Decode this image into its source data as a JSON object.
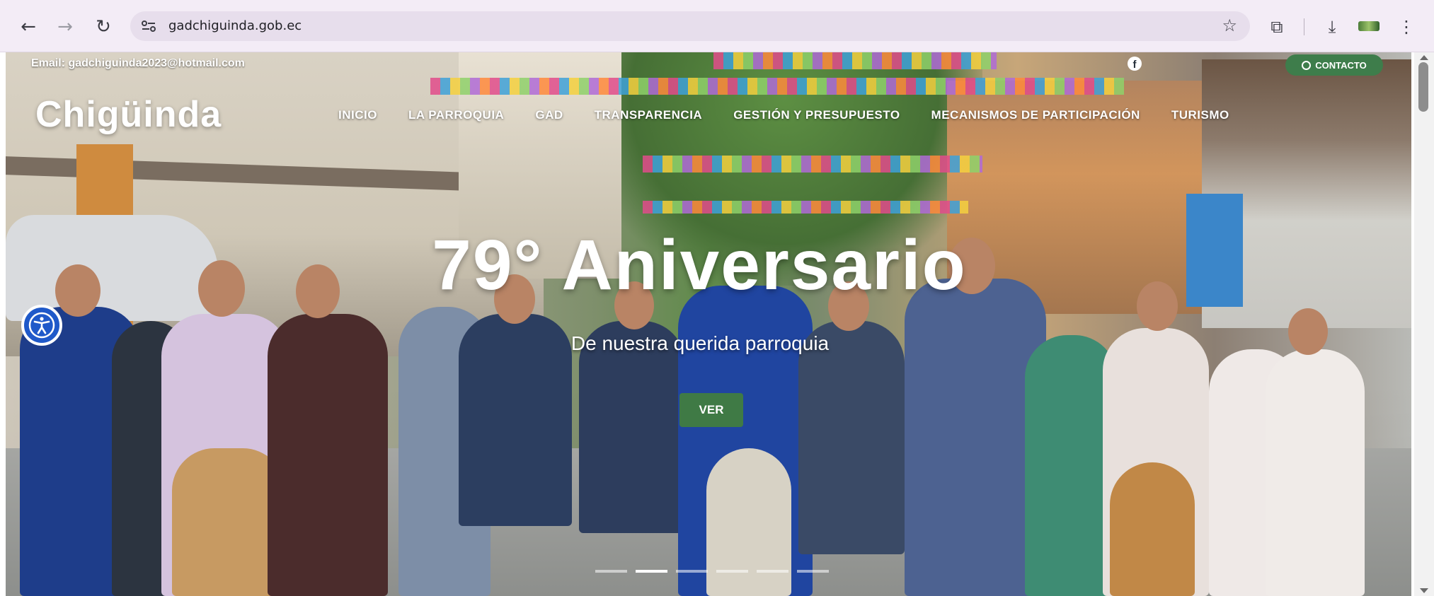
{
  "browser": {
    "url": "gadchiguinda.gob.ec",
    "back_icon": "←",
    "forward_icon": "→",
    "reload_icon": "↻",
    "star_icon": "☆",
    "extensions_icon": "⧉",
    "download_icon": "⤓",
    "menu_icon": "⋮"
  },
  "topbar": {
    "email": "Email: gadchiguinda2023@hotmail.com",
    "facebook_letter": "f",
    "contact_label": "CONTACTO"
  },
  "site": {
    "logo": "Chigüinda"
  },
  "nav": {
    "items": [
      {
        "label": "INICIO"
      },
      {
        "label": "LA PARROQUIA"
      },
      {
        "label": "GAD"
      },
      {
        "label": "TRANSPARENCIA"
      },
      {
        "label": "GESTIÓN Y PRESUPUESTO"
      },
      {
        "label": "MECANISMOS DE PARTICIPACIÓN"
      },
      {
        "label": "TURISMO"
      }
    ]
  },
  "hero": {
    "title": "79° Aniversario",
    "subtitle": "De nuestra querida parroquia",
    "button_label": "VER",
    "slides": 6,
    "active_slide": 2
  },
  "colors": {
    "accent_green": "#3f7a45",
    "accessibility_blue": "#1f59c9",
    "browser_bar": "#f3ecf6"
  }
}
